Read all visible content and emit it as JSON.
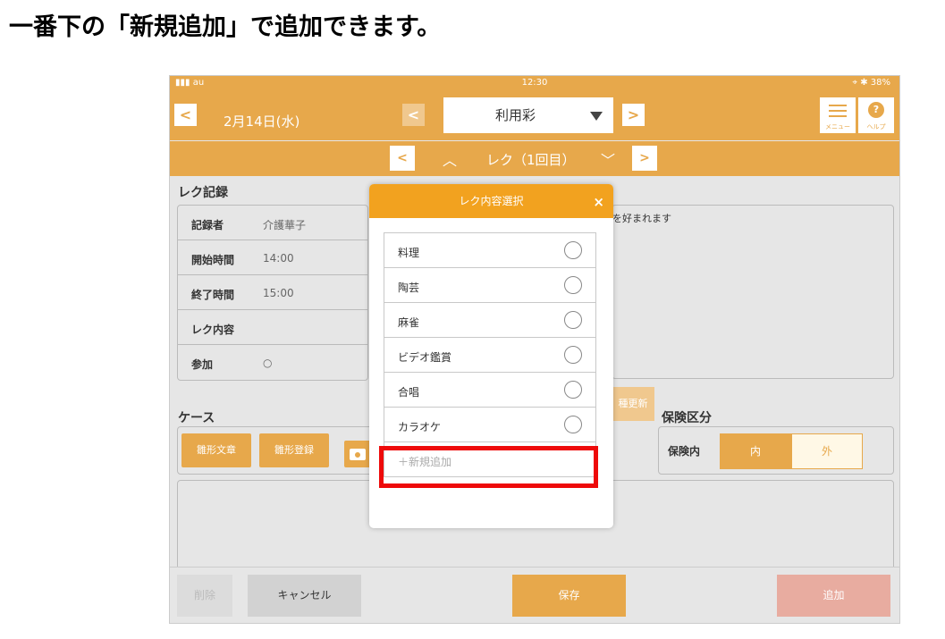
{
  "caption": "一番下の「新規追加」で追加できます。",
  "status_bar": {
    "carrier": "▮▮▮ au",
    "time": "12:30",
    "right": "⌖ ✱ 38%"
  },
  "header": {
    "back": "<",
    "date": "2月14日(水)",
    "prev": "<",
    "user": "利用彩",
    "next": ">",
    "menu_label": "メニュー",
    "help_glyph": "?",
    "help_label": "ヘルプ"
  },
  "subnav": {
    "prev": "<",
    "up": "︿",
    "title": "レク（1回目）",
    "down": "﹀",
    "next": ">"
  },
  "records": {
    "title": "レク記録",
    "rows": [
      {
        "label": "記録者",
        "value": "介護華子"
      },
      {
        "label": "開始時間",
        "value": "14:00"
      },
      {
        "label": "終了時間",
        "value": "15:00"
      },
      {
        "label": "レク内容",
        "value": ""
      },
      {
        "label": "参加",
        "value": "○"
      }
    ]
  },
  "right_text": "を好まれます",
  "update_button": "種更新",
  "case": {
    "title": "ケース",
    "template_text_btn": "雛形文章",
    "template_register_btn": "雛形登録"
  },
  "insurance": {
    "title": "保険区分",
    "label": "保険内",
    "in": "内",
    "out": "外"
  },
  "bottom": {
    "delete": "削除",
    "cancel": "キャンセル",
    "save": "保存",
    "add": "追加"
  },
  "modal": {
    "title": "レク内容選択",
    "close": "×",
    "options": [
      "料理",
      "陶芸",
      "麻雀",
      "ビデオ鑑賞",
      "合唱",
      "カラオケ"
    ],
    "new_item": "＋新規追加"
  },
  "colors": {
    "accent": "#e7a84b",
    "modal_header": "#f2a21f",
    "highlight": "#ee0a0a",
    "add_button": "#e8aca0"
  }
}
